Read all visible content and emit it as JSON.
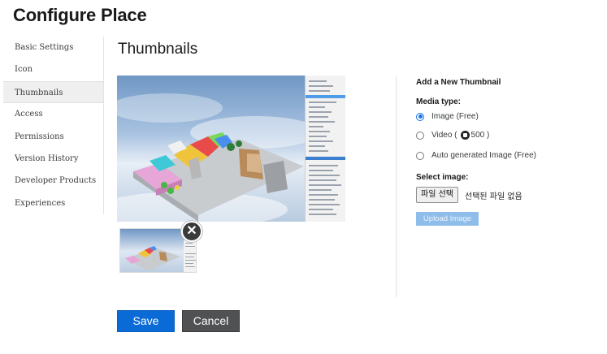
{
  "page": {
    "title": "Configure Place"
  },
  "sidebar": {
    "items": [
      {
        "label": "Basic Settings"
      },
      {
        "label": "Icon"
      },
      {
        "label": "Thumbnails"
      },
      {
        "label": "Access"
      },
      {
        "label": "Permissions"
      },
      {
        "label": "Version History"
      },
      {
        "label": "Developer Products"
      },
      {
        "label": "Experiences"
      }
    ],
    "active_index": 2
  },
  "main": {
    "section_title": "Thumbnails"
  },
  "thumbnail_panel": {
    "title": "Add a New Thumbnail",
    "media_type_label": "Media type:",
    "options": [
      {
        "label": "Image (Free)",
        "checked": true
      },
      {
        "label_prefix": "Video (",
        "price": "500",
        "label_suffix": ")",
        "icon": "robux-icon",
        "checked": false
      },
      {
        "label": "Auto generated Image (Free)",
        "checked": false
      }
    ],
    "select_image_label": "Select image:",
    "file_button_label": "파일 선택",
    "file_status": "선택된 파일 없음",
    "upload_button_label": "Upload Image"
  },
  "actions": {
    "save_label": "Save",
    "cancel_label": "Cancel"
  },
  "colors": {
    "primary": "#0a6bd6",
    "secondary": "#4f5153",
    "upload_disabled": "#8fbde9",
    "radio_accent": "#1a73e8"
  }
}
